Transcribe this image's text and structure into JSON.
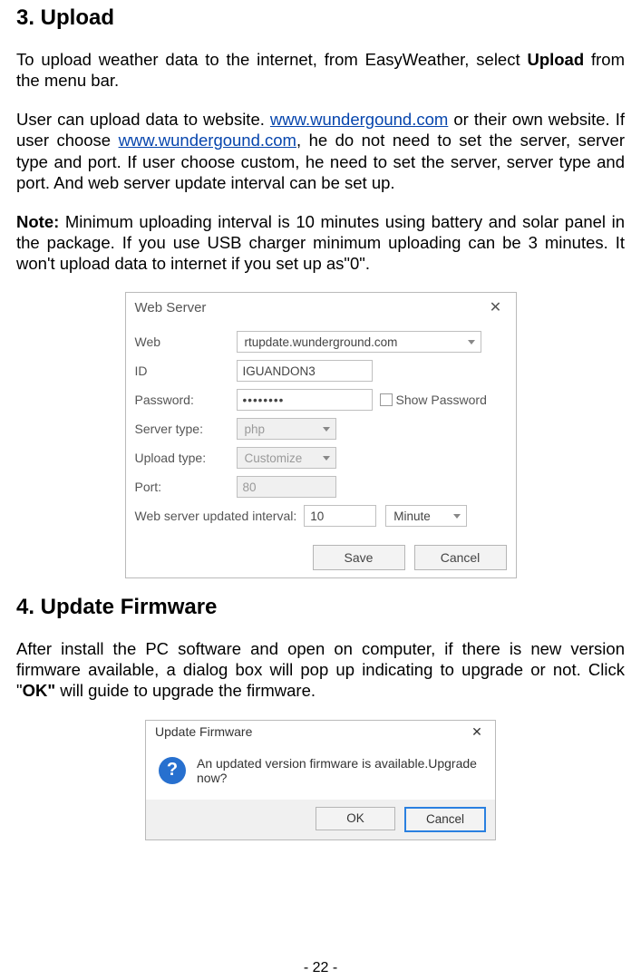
{
  "section1": {
    "heading": "3. Upload",
    "p1_a": "To upload weather data to the internet, from EasyWeather, select ",
    "p1_b": "Upload",
    "p1_c": " from the menu bar.",
    "p2_a": "User can upload data to website. ",
    "link1": "www.wundergound.com",
    "p2_b": " or their own website. If user choose ",
    "link2": "www.wundergound.com",
    "p2_c": ", he do not need to set the server, server type and port. If user choose custom, he need to set the server, server type and port. And web server update interval can be set up.",
    "p3_a": "Note:",
    "p3_b": " Minimum uploading interval is 10 minutes using battery and solar panel in the package. If you use USB charger minimum uploading can be 3 minutes. It won't upload data to internet if you set up as\"0\"."
  },
  "webserver": {
    "title": "Web Server",
    "labels": {
      "web": "Web",
      "id": "ID",
      "password": "Password:",
      "servertype": "Server type:",
      "uploadtype": "Upload type:",
      "port": "Port:",
      "interval": "Web server updated interval:"
    },
    "values": {
      "web": "rtupdate.wunderground.com",
      "id": "IGUANDON3",
      "password": "••••••••",
      "servertype": "php",
      "uploadtype": "Customize",
      "port": "80",
      "interval_val": "10",
      "interval_unit": "Minute"
    },
    "showpwd": "Show Password",
    "save": "Save",
    "cancel": "Cancel"
  },
  "section2": {
    "heading": "4. Update Firmware",
    "p_a": "After install the PC software and open on computer, if there is new version firmware available, a dialog box will pop up indicating to upgrade or not. Click \"",
    "p_b": "OK\"",
    "p_c": " will guide to upgrade the firmware."
  },
  "updatefw": {
    "title": "Update Firmware",
    "message": "An updated version firmware is available.Upgrade now?",
    "ok": "OK",
    "cancel": "Cancel"
  },
  "pagenum": "- 22 -"
}
